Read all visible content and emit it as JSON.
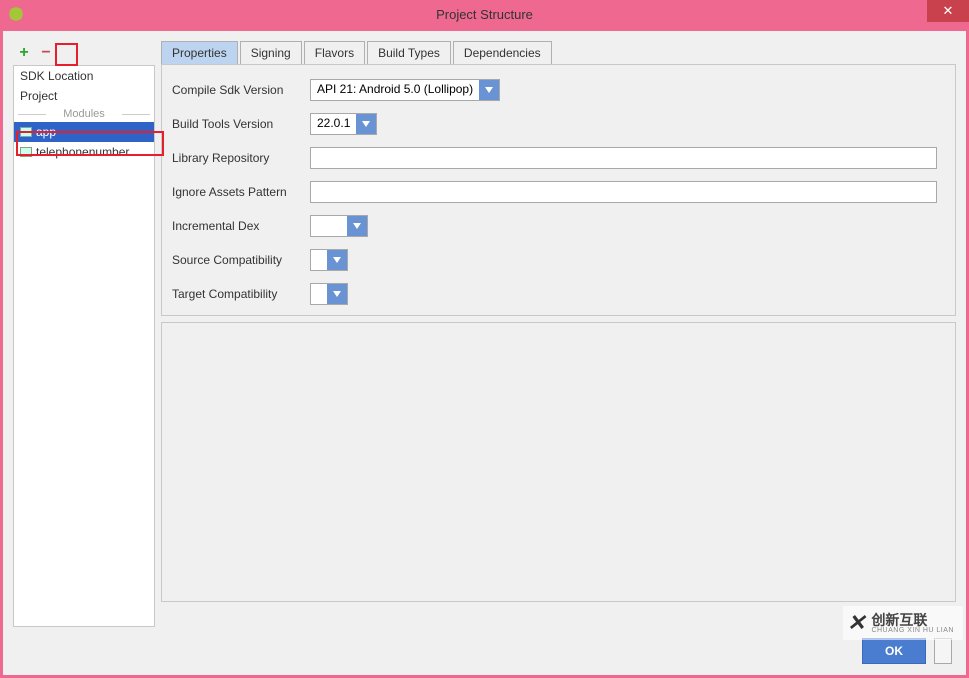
{
  "window": {
    "title": "Project Structure",
    "close_glyph": "✕"
  },
  "sidebar": {
    "tools": {
      "add": "+",
      "remove": "−"
    },
    "items": [
      {
        "label": "SDK Location"
      },
      {
        "label": "Project"
      }
    ],
    "modules_header": "Modules",
    "modules": [
      {
        "label": "app",
        "selected": true
      },
      {
        "label": "telephonenumber",
        "selected": false
      }
    ]
  },
  "tabs": [
    {
      "label": "Properties",
      "active": true
    },
    {
      "label": "Signing",
      "active": false
    },
    {
      "label": "Flavors",
      "active": false
    },
    {
      "label": "Build Types",
      "active": false
    },
    {
      "label": "Dependencies",
      "active": false
    }
  ],
  "form": {
    "compile_sdk": {
      "label": "Compile Sdk Version",
      "value": "API 21: Android 5.0 (Lollipop)"
    },
    "build_tools": {
      "label": "Build Tools Version",
      "value": "22.0.1"
    },
    "library_repo": {
      "label": "Library Repository",
      "value": ""
    },
    "ignore_assets": {
      "label": "Ignore Assets Pattern",
      "value": ""
    },
    "incremental_dex": {
      "label": "Incremental Dex",
      "value": ""
    },
    "source_compat": {
      "label": "Source Compatibility",
      "value": ""
    },
    "target_compat": {
      "label": "Target Compatibility",
      "value": ""
    }
  },
  "footer": {
    "ok": "OK"
  },
  "watermark": {
    "brand": "创新互联",
    "sub": "CHUANG XIN HU LIAN"
  }
}
